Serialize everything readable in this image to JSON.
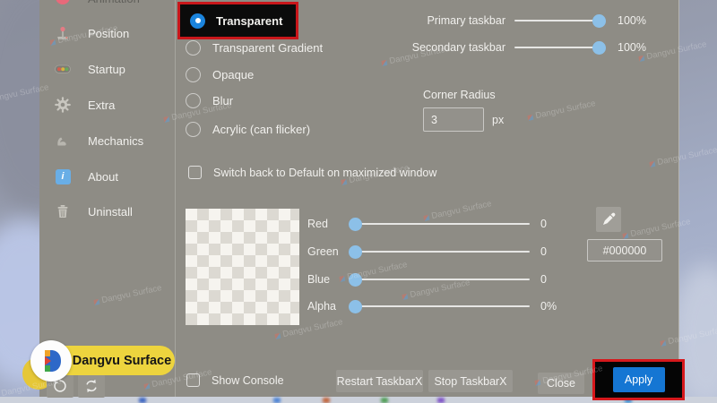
{
  "watermark": {
    "text": "Dangvu Surface"
  },
  "sidebar": {
    "items": [
      {
        "label": "Animation"
      },
      {
        "label": "Position"
      },
      {
        "label": "Startup"
      },
      {
        "label": "Extra"
      },
      {
        "label": "Mechanics"
      },
      {
        "label": "About"
      },
      {
        "label": "Uninstall"
      }
    ],
    "about_badge": "i"
  },
  "appearance": {
    "selected_option": "Transparent",
    "options": [
      "Transparent Gradient",
      "Opaque",
      "Blur",
      "Acrylic (can flicker)"
    ]
  },
  "opacity": {
    "rows": [
      {
        "label": "Primary taskbar",
        "value": "100%"
      },
      {
        "label": "Secondary taskbar",
        "value": "100%"
      }
    ]
  },
  "corner_radius": {
    "label": "Corner Radius",
    "value": "3",
    "unit": "px"
  },
  "maximized": {
    "label": "Switch back to Default on maximized window",
    "checked": false
  },
  "color_mixer": {
    "channels": [
      {
        "label": "Red",
        "value": "0"
      },
      {
        "label": "Green",
        "value": "0"
      },
      {
        "label": "Blue",
        "value": "0"
      },
      {
        "label": "Alpha",
        "value": "0%"
      }
    ],
    "hex": "#000000"
  },
  "footer": {
    "show_console": "Show Console",
    "show_console_checked": false,
    "restart": "Restart TaskbarX",
    "stop": "Stop TaskbarX",
    "close": "Close",
    "apply": "Apply"
  },
  "branding": {
    "name": "Dangvu Surface"
  },
  "colors": {
    "panel_gray": "#8e8c85",
    "accent_blue": "#1576d3",
    "annotation_red": "#d6181c",
    "slider_thumb": "#8cc0e8",
    "brand_yellow": "#edd43e",
    "radio_selected_blue": "#1b84dd"
  }
}
